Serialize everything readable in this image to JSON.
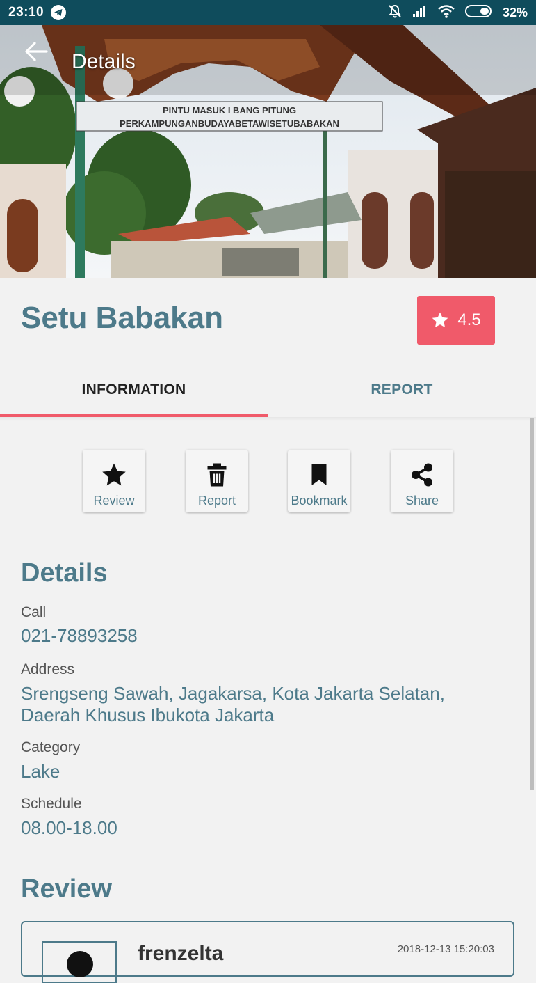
{
  "status_bar": {
    "time": "23:10",
    "battery": "32%",
    "icons": [
      "telegram-icon",
      "mute-icon",
      "signal-icon",
      "wifi-icon",
      "battery-icon"
    ]
  },
  "app_bar": {
    "title": "Details",
    "back_icon": "arrow-left-icon"
  },
  "hero": {
    "sign_line_1": "PINTU MASUK I BANG PITUNG",
    "sign_line_2": "PERKAMPUNGANBUDAYABETAWISETUBABAKAN"
  },
  "place": {
    "name": "Setu Babakan",
    "rating": "4.5"
  },
  "tabs": [
    {
      "label": "INFORMATION",
      "active": true
    },
    {
      "label": "REPORT",
      "active": false
    }
  ],
  "actions": [
    {
      "label": "Review",
      "icon": "star-icon"
    },
    {
      "label": "Report",
      "icon": "trash-icon"
    },
    {
      "label": "Bookmark",
      "icon": "bookmark-icon"
    },
    {
      "label": "Share",
      "icon": "share-icon"
    }
  ],
  "details": {
    "title": "Details",
    "call_label": "Call",
    "call_value": "021-78893258",
    "address_label": "Address",
    "address_line_1": "Srengseng Sawah, Jagakarsa, Kota Jakarta Selatan,",
    "address_line_2": "Daerah Khusus Ibukota Jakarta",
    "category_label": "Category",
    "category_value": "Lake",
    "schedule_label": "Schedule",
    "schedule_value": "08.00-18.00"
  },
  "review": {
    "title": "Review",
    "user": "frenzelta",
    "date": "2018-12-13 15:20:03"
  },
  "colors": {
    "status_bar": "#0f4c5c",
    "accent": "#f05a6a",
    "primary_text": "#4d7a8a"
  }
}
